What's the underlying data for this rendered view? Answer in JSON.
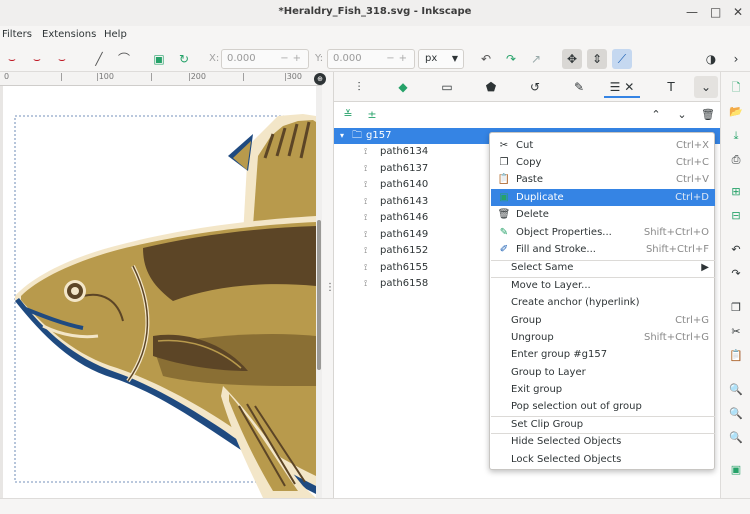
{
  "window": {
    "title": "*Heraldry_Fish_318.svg - Inkscape",
    "minimize": "—",
    "maximize": "□",
    "close": "✕"
  },
  "menu": [
    "Filters",
    "Extensions",
    "Help"
  ],
  "toolcontrols": {
    "x_label": "X:",
    "x_value": "0.000",
    "y_label": "Y:",
    "y_value": "0.000",
    "unit": "px"
  },
  "ruler": {
    "labels": [
      "0",
      "|",
      "|100",
      "|",
      "|200",
      "|",
      "|300"
    ]
  },
  "dock": {
    "tree": {
      "group": "g157",
      "children": [
        "path6134",
        "path6137",
        "path6140",
        "path6143",
        "path6146",
        "path6149",
        "path6152",
        "path6155",
        "path6158"
      ]
    }
  },
  "context_menu": {
    "items": [
      {
        "label": "Cut",
        "accel": "Ctrl+X",
        "icon": "cut-icon",
        "glyph": "✂"
      },
      {
        "label": "Copy",
        "accel": "Ctrl+C",
        "icon": "copy-icon",
        "glyph": "❐"
      },
      {
        "label": "Paste",
        "accel": "Ctrl+V",
        "icon": "paste-icon",
        "glyph": "📋"
      },
      {
        "label": "Duplicate",
        "accel": "Ctrl+D",
        "icon": "duplicate-icon",
        "glyph": "▣",
        "highlighted": true
      },
      {
        "label": "Delete",
        "accel": "",
        "icon": "trash-icon",
        "glyph": "🗑"
      },
      {
        "label": "Object Properties...",
        "accel": "Shift+Ctrl+O",
        "icon": "object-properties-icon",
        "glyph": "✎"
      },
      {
        "label": "Fill and Stroke...",
        "accel": "Shift+Ctrl+F",
        "icon": "fill-stroke-icon",
        "glyph": "✐"
      },
      {
        "label": "Select Same",
        "accel": "",
        "icon": "",
        "glyph": "",
        "submenu": true
      },
      {
        "label": "Move to Layer...",
        "accel": ""
      },
      {
        "label": "Create anchor (hyperlink)",
        "accel": ""
      },
      {
        "label": "Group",
        "accel": "Ctrl+G"
      },
      {
        "label": "Ungroup",
        "accel": "Shift+Ctrl+G"
      },
      {
        "label": "Enter group #g157",
        "accel": ""
      },
      {
        "label": "Group to Layer",
        "accel": ""
      },
      {
        "label": "Exit group",
        "accel": ""
      },
      {
        "label": "Pop selection out of group",
        "accel": ""
      },
      {
        "label": "Set Clip Group",
        "accel": ""
      },
      {
        "label": "Hide Selected Objects",
        "accel": ""
      },
      {
        "label": "Lock Selected Objects",
        "accel": ""
      }
    ]
  },
  "colors": {
    "accent": "#3584e4",
    "fish_body": "#b89a4c",
    "fish_dark": "#5c4526",
    "fish_outline": "#1f4a80",
    "fish_cream": "#f3e6c8"
  }
}
